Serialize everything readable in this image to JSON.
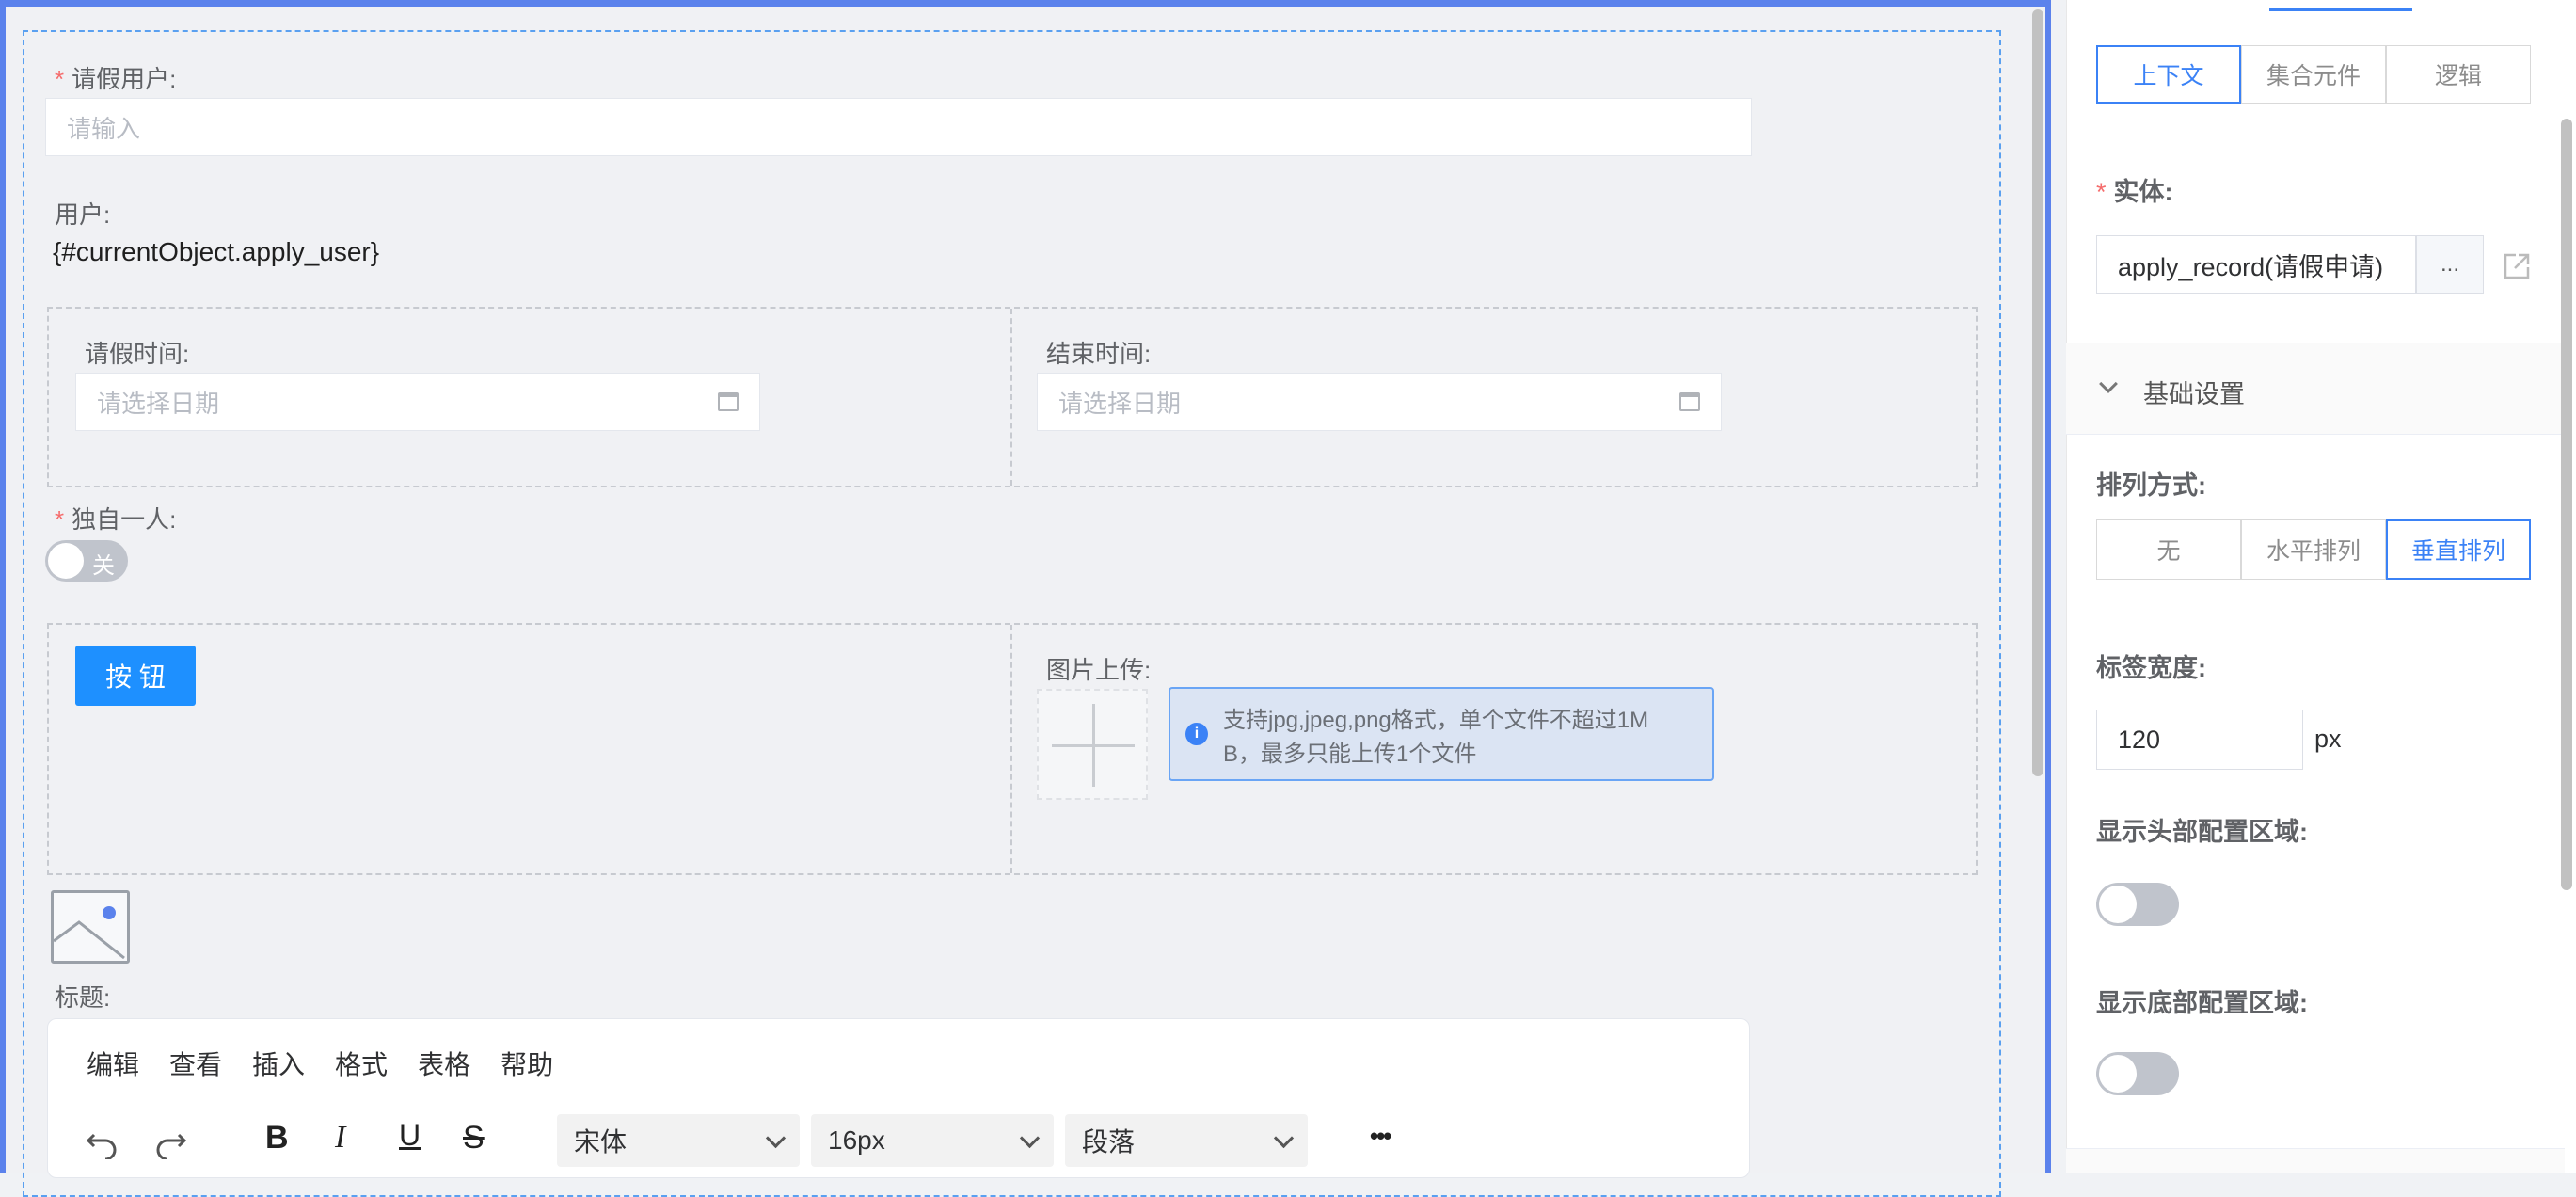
{
  "form": {
    "leave_user": {
      "label": "请假用户:",
      "required_mark": "*",
      "placeholder": "请输入"
    },
    "user": {
      "label": "用户:",
      "value": "{#currentObject.apply_user}"
    },
    "start_time": {
      "label": "请假时间:",
      "placeholder": "请选择日期"
    },
    "end_time": {
      "label": "结束时间:",
      "placeholder": "请选择日期"
    },
    "alone": {
      "label": "独自一人:",
      "required_mark": "*",
      "switch_text": "关"
    },
    "button": {
      "label": "按 钮"
    },
    "upload": {
      "label": "图片上传:",
      "tip_line1": "支持jpg,jpeg,png格式，单个文件不超过1M",
      "tip_line2": "B，最多只能上传1个文件"
    },
    "title": {
      "label": "标题:"
    },
    "editor": {
      "menus": [
        "编辑",
        "查看",
        "插入",
        "格式",
        "表格",
        "帮助"
      ],
      "bold": "B",
      "italic": "I",
      "underline": "U",
      "strike": "S",
      "font_family": "宋体",
      "font_size": "16px",
      "block": "段落",
      "more": "•••"
    }
  },
  "panel": {
    "tabs": [
      "上下文",
      "集合元件",
      "逻辑"
    ],
    "active_tab": 0,
    "entity": {
      "label": "实体:",
      "required_mark": "*",
      "value": "apply_record(请假申请)",
      "more": "..."
    },
    "section": {
      "title": "基础设置"
    },
    "arrange": {
      "label": "排列方式:",
      "options": [
        "无",
        "水平排列",
        "垂直排列"
      ],
      "active": 2
    },
    "label_width": {
      "label": "标签宽度:",
      "value": "120",
      "unit": "px"
    },
    "show_header": {
      "label": "显示头部配置区域:",
      "on": false
    },
    "show_footer": {
      "label": "显示底部配置区域:",
      "on": false
    }
  },
  "colors": {
    "accent": "#3b82f6",
    "required": "#f56c6c",
    "button": "#1e90ff",
    "selection": "#5b82ec"
  }
}
